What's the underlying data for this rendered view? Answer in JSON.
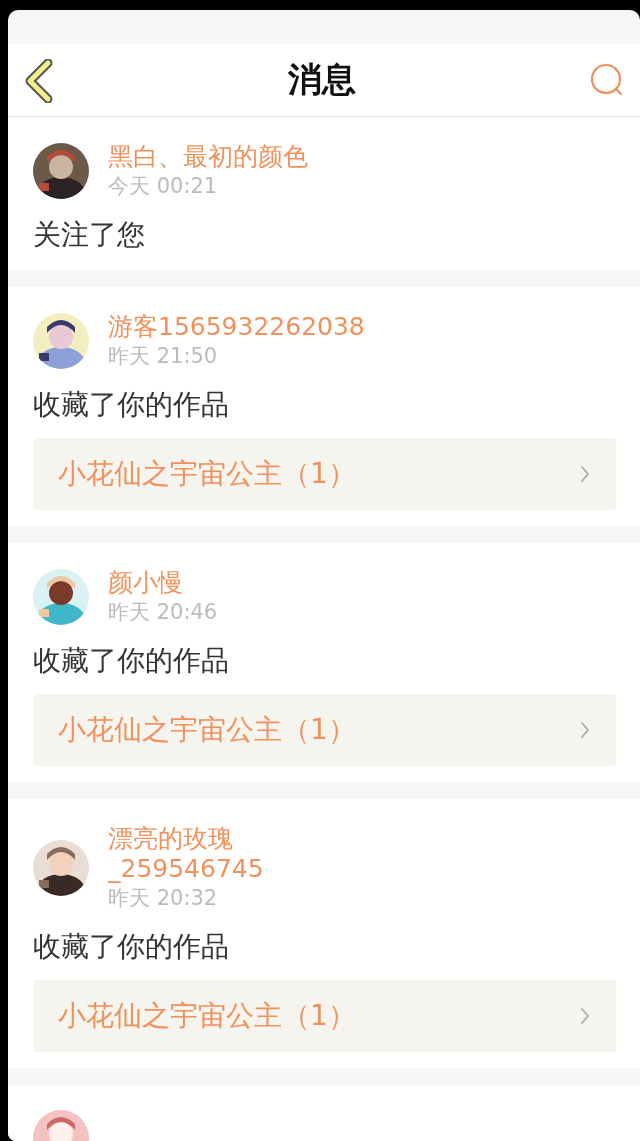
{
  "header": {
    "title": "消息"
  },
  "messages": [
    {
      "kind": "follow",
      "name": "黑白、最初的颜色",
      "time": "今天 00:21",
      "text": "关注了您"
    },
    {
      "kind": "favorite",
      "name": "游客1565932262038",
      "time": "昨天 21:50",
      "text": "收藏了你的作品",
      "work": "小花仙之宇宙公主（1）"
    },
    {
      "kind": "favorite",
      "name": "颜小慢",
      "time": "昨天 20:46",
      "text": "收藏了你的作品",
      "work": "小花仙之宇宙公主（1）"
    },
    {
      "kind": "favorite",
      "name": "漂亮的玫瑰_259546745",
      "time": "昨天 20:32",
      "text": "收藏了你的作品",
      "work": "小花仙之宇宙公主（1）"
    },
    {
      "kind": "partial"
    }
  ]
}
